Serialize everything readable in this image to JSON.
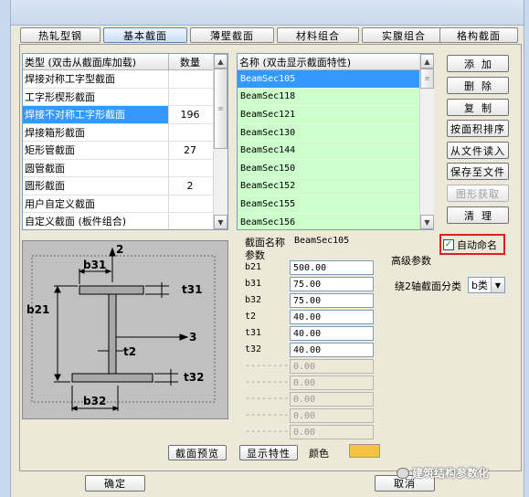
{
  "tabs": [
    {
      "label": "热轧型钢"
    },
    {
      "label": "基本截面"
    },
    {
      "label": "薄壁截面"
    },
    {
      "label": "材料组合"
    },
    {
      "label": "实腹组合"
    },
    {
      "label": "格构截面"
    }
  ],
  "type_list": {
    "col_type": "类型 (双击从截面库加载)",
    "col_count": "数量",
    "rows": [
      {
        "name": "焊接对称工字型截面",
        "count": ""
      },
      {
        "name": "工字形楔形截面",
        "count": ""
      },
      {
        "name": "焊接不对称工字形截面",
        "count": "196"
      },
      {
        "name": "焊接箱形截面",
        "count": ""
      },
      {
        "name": "矩形管截面",
        "count": "27"
      },
      {
        "name": "圆管截面",
        "count": ""
      },
      {
        "name": "圆形截面",
        "count": "2"
      },
      {
        "name": "用户自定义截面",
        "count": ""
      },
      {
        "name": "自定义截面 (板件组合)",
        "count": ""
      }
    ]
  },
  "name_list": {
    "col_name": "名称 (双击显示截面特性)",
    "rows": [
      "BeamSec105",
      "BeamSec118",
      "BeamSec121",
      "BeamSec130",
      "BeamSec144",
      "BeamSec150",
      "BeamSec152",
      "BeamSec155",
      "BeamSec156"
    ]
  },
  "buttons": {
    "add": "添加",
    "delete": "删除",
    "copy": "复制",
    "sort_area": "按面积排序",
    "import_file": "从文件读入",
    "save_file": "保存至文件",
    "get_graphic": "图形获取",
    "clear": "清理",
    "preview": "截面预览",
    "show_props": "显示特性",
    "ok": "确定",
    "cancel": "取消"
  },
  "section": {
    "name_label": "截面名称",
    "name_value": "BeamSec105",
    "params_label": "参数",
    "auto_name_label": "自动命名",
    "auto_name_checked": "✓",
    "advanced_label": "高级参数",
    "axis2_label": "绕2轴截面分类",
    "axis2_value": "b类",
    "color_label": "颜色",
    "color_value": "#f5c242",
    "params": [
      {
        "label": "b21",
        "value": "500.00"
      },
      {
        "label": "b31",
        "value": "75.00"
      },
      {
        "label": "b32",
        "value": "75.00"
      },
      {
        "label": "t2",
        "value": "40.00"
      },
      {
        "label": "t31",
        "value": "40.00"
      },
      {
        "label": "t32",
        "value": "40.00"
      }
    ],
    "disabled_params": [
      {
        "label": "--------",
        "value": "0.00"
      },
      {
        "label": "--------",
        "value": "0.00"
      },
      {
        "label": "--------",
        "value": "0.00"
      },
      {
        "label": "--------",
        "value": "0.00"
      },
      {
        "label": "--------",
        "value": "0.00"
      }
    ]
  },
  "diagram": {
    "b31": "b31",
    "t31": "t31",
    "b21": "b21",
    "t2": "t2",
    "t32": "t32",
    "b32": "b32",
    "axis2": "2",
    "axis3": "3"
  },
  "watermark": "建筑结构参数化"
}
